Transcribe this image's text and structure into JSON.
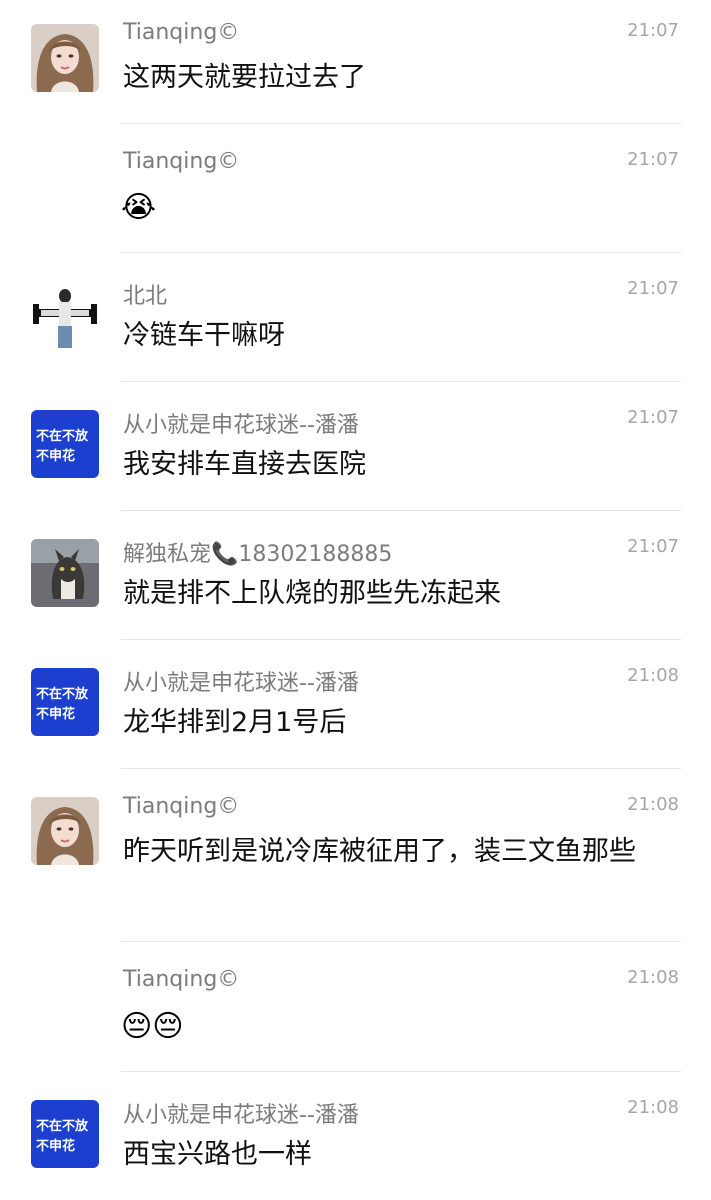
{
  "messages": [
    {
      "sender": "Tianqing©",
      "time": "21:07",
      "text": "这两天就要拉过去了",
      "avatar": "girl-avatar"
    },
    {
      "sender": "Tianqing©",
      "time": "21:07",
      "text": "😭",
      "avatar": ""
    },
    {
      "sender": "北北",
      "time": "21:07",
      "text": "冷链车干嘛呀",
      "avatar": "gym-girl-avatar"
    },
    {
      "sender": "从小就是申花球迷--潘潘",
      "time": "21:07",
      "text": "我安排车直接去医院",
      "avatar": "shenhua-logo-avatar"
    },
    {
      "sender": "解独私宠📞18302188885",
      "time": "21:07",
      "text": "就是排不上队烧的那些先冻起来",
      "avatar": "cat-avatar"
    },
    {
      "sender": "从小就是申花球迷--潘潘",
      "time": "21:08",
      "text": "龙华排到2月1号后",
      "avatar": "shenhua-logo-avatar"
    },
    {
      "sender": "Tianqing©",
      "time": "21:08",
      "text": "昨天听到是说冷库被征用了，装三文鱼那些",
      "avatar": "girl-avatar"
    },
    {
      "sender": "Tianqing©",
      "time": "21:08",
      "text": "😔😔",
      "avatar": ""
    },
    {
      "sender": "从小就是申花球迷--潘潘",
      "time": "21:08",
      "text": "西宝兴路也一样",
      "avatar": "shenhua-logo-avatar"
    }
  ],
  "colors": {
    "sender": "#7c7c7c",
    "time": "#a6a6a6",
    "text": "#111111",
    "divider": "#e4e4e4",
    "shenhua_blue": "#1d3fd0"
  }
}
